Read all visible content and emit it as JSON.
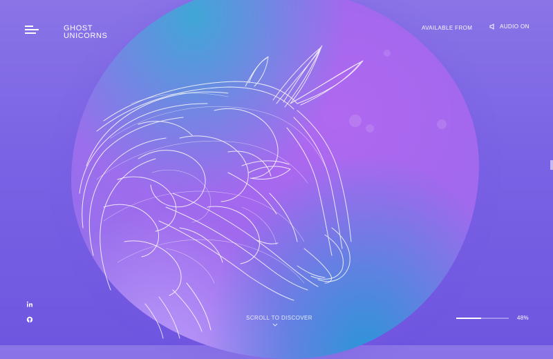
{
  "brand": {
    "line1": "GHOST",
    "line2": "UNICORNS"
  },
  "nav": {
    "available_label": "AVAILABLE FROM",
    "audio_label": "AUDIO ON",
    "menu_icon": "hamburger-menu-icon",
    "audio_icon": "speaker-icon"
  },
  "social": [
    {
      "name": "linkedin",
      "icon": "linkedin-icon",
      "text": "in"
    },
    {
      "name": "github",
      "icon": "github-icon"
    }
  ],
  "footer": {
    "scroll_label": "SCROLL TO DISCOVER",
    "progress_percent": 48,
    "progress_label": "48%"
  },
  "colors": {
    "background_top": "#8a74e6",
    "background_bottom": "#6f56e0",
    "blob_core": "#b068f0",
    "blob_accent": "#2896d7",
    "line_art": "#ffffff"
  }
}
